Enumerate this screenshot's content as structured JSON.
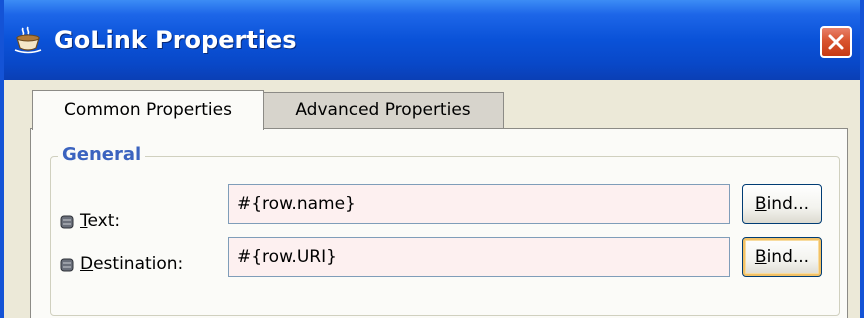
{
  "window": {
    "title": "GoLink Properties",
    "icon": "coffee-cup-icon",
    "colors": {
      "titlebar": "#0a52d8",
      "close_button": "#d9542f",
      "group_title": "#3b63bf",
      "field_background": "#fdf0f0"
    }
  },
  "tabs": [
    {
      "label": "Common Properties",
      "selected": true
    },
    {
      "label": "Advanced Properties",
      "selected": false
    }
  ],
  "group": {
    "title": "General",
    "rows": [
      {
        "label_mnemonic": "T",
        "label_rest": "ext:",
        "value": "#{row.name}",
        "button_mnemonic": "B",
        "button_rest": "ind...",
        "button_focused": false
      },
      {
        "label_mnemonic": "D",
        "label_rest": "estination:",
        "value": "#{row.URI}",
        "button_mnemonic": "B",
        "button_rest": "ind...",
        "button_focused": true
      }
    ]
  }
}
